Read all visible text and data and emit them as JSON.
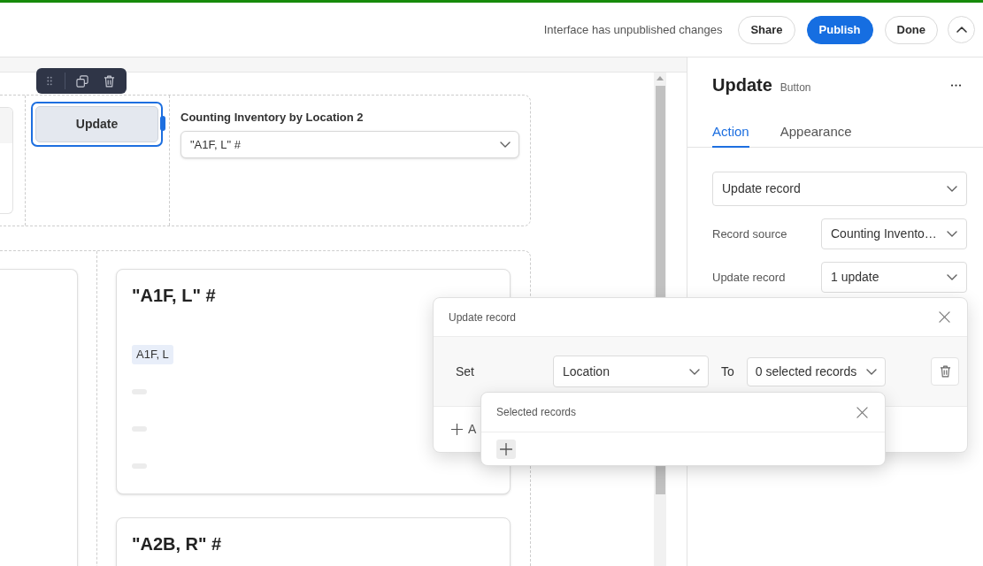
{
  "top_bar": {
    "status_text": "Interface has unpublished changes",
    "buttons": [
      {
        "label": "Share",
        "kind": "outline"
      },
      {
        "label": "Publish",
        "kind": "primary"
      },
      {
        "label": "Done",
        "kind": "outline"
      }
    ]
  },
  "canvas": {
    "button_element": {
      "label": "Update",
      "selected": true
    },
    "dropdown_element": {
      "label": "Counting Inventory by Location 2",
      "value": "\"A1F, L\" #"
    },
    "cards": [
      {
        "title": "\"A1F, L\" #",
        "fields": [
          {
            "kind": "tag",
            "value": "A1F, L"
          },
          {
            "kind": "empty"
          },
          {
            "kind": "empty"
          },
          {
            "kind": "empty"
          }
        ]
      },
      {
        "title": "\"A2B, R\" #"
      }
    ]
  },
  "properties_panel": {
    "title": "Update",
    "subtitle": "Button",
    "tabs": [
      {
        "label": "Action",
        "selected": true
      },
      {
        "label": "Appearance",
        "selected": false
      }
    ],
    "action": "Update record",
    "settings": [
      {
        "label": "Record source",
        "value": "Counting Invento…"
      },
      {
        "label": "Update record",
        "value": "1 update"
      }
    ]
  },
  "update_record_popup": {
    "title": "Update record",
    "set_label": "Set",
    "field": "Location",
    "to_label": "To",
    "value": "0 selected records",
    "add_button": "A"
  },
  "selected_records_popup": {
    "title": "Selected records"
  }
}
